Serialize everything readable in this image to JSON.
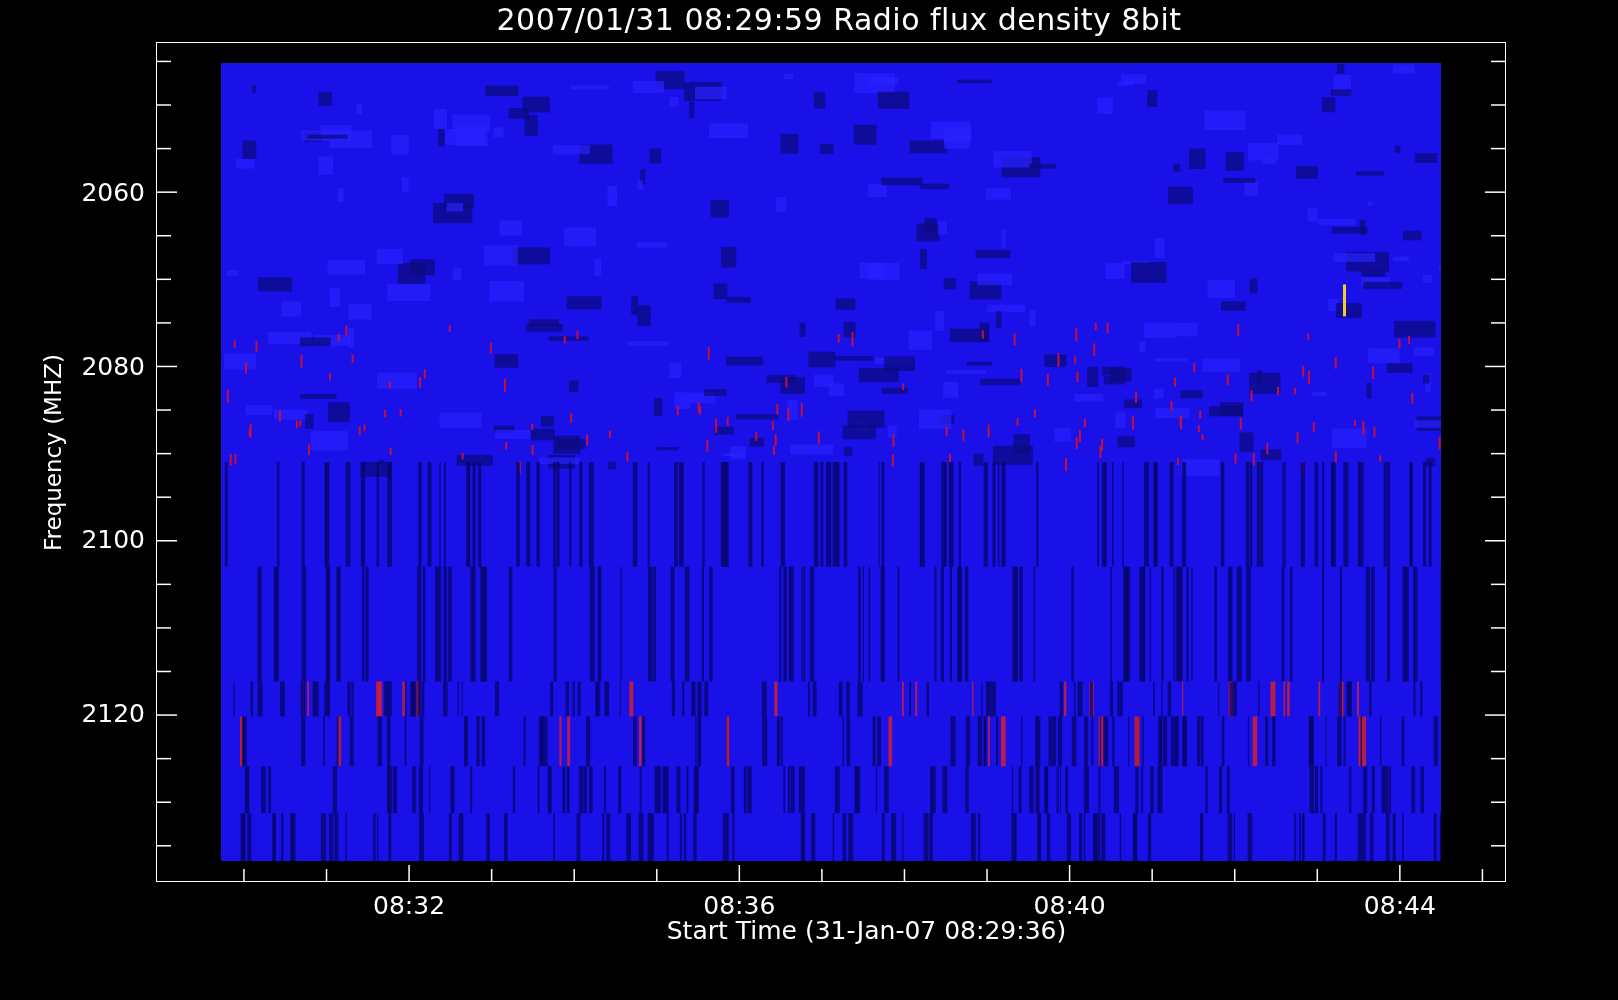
{
  "title": "2007/01/31 08:29:59 Radio flux density 8bit",
  "y_axis": {
    "label": "Frequency (MHZ)",
    "ticks": [
      "2060",
      "2080",
      "2100",
      "2120"
    ]
  },
  "x_axis": {
    "label": "Start Time (31-Jan-07 08:29:36)",
    "ticks": [
      "08:32",
      "08:36",
      "08:40",
      "08:44"
    ]
  }
}
